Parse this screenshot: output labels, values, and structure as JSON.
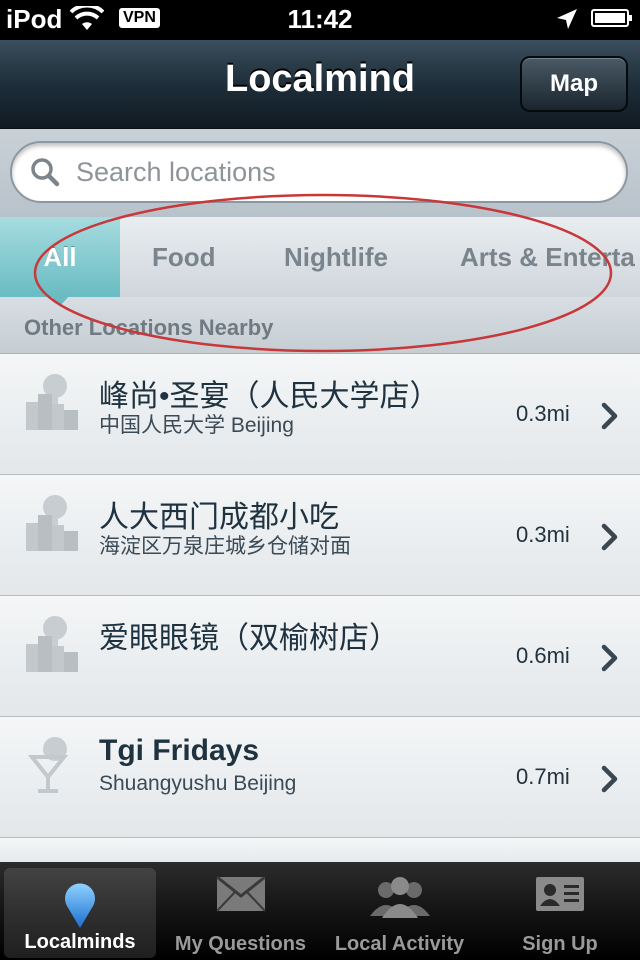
{
  "status_bar": {
    "carrier": "iPod",
    "vpn": "VPN",
    "time": "11:42"
  },
  "nav": {
    "title": "Localmind",
    "map_button": "Map"
  },
  "search": {
    "placeholder": "Search locations"
  },
  "categories": [
    "All",
    "Food",
    "Nightlife",
    "Arts & Enterta"
  ],
  "section_header": "Other Locations Nearby",
  "locations": [
    {
      "name": "峰尚•圣宴（人民大学店）",
      "address": "中国人民大学 Beijing",
      "distance": "0.3mi",
      "icon": "building-icon"
    },
    {
      "name": "人大西门成都小吃",
      "address": "海淀区万泉庄城乡仓储对面",
      "distance": "0.3mi",
      "icon": "building-icon"
    },
    {
      "name": "爱眼眼镜（双榆树店）",
      "address": "",
      "distance": "0.6mi",
      "icon": "building-icon"
    },
    {
      "name": "Tgi Fridays",
      "address": "Shuangyushu Beijing",
      "distance": "0.7mi",
      "icon": "cocktail-icon"
    }
  ],
  "tabs": [
    "Localminds",
    "My Questions",
    "Local Activity",
    "Sign Up"
  ],
  "colors": {
    "accent": "#69bcc2",
    "annotation": "#c8383a"
  }
}
